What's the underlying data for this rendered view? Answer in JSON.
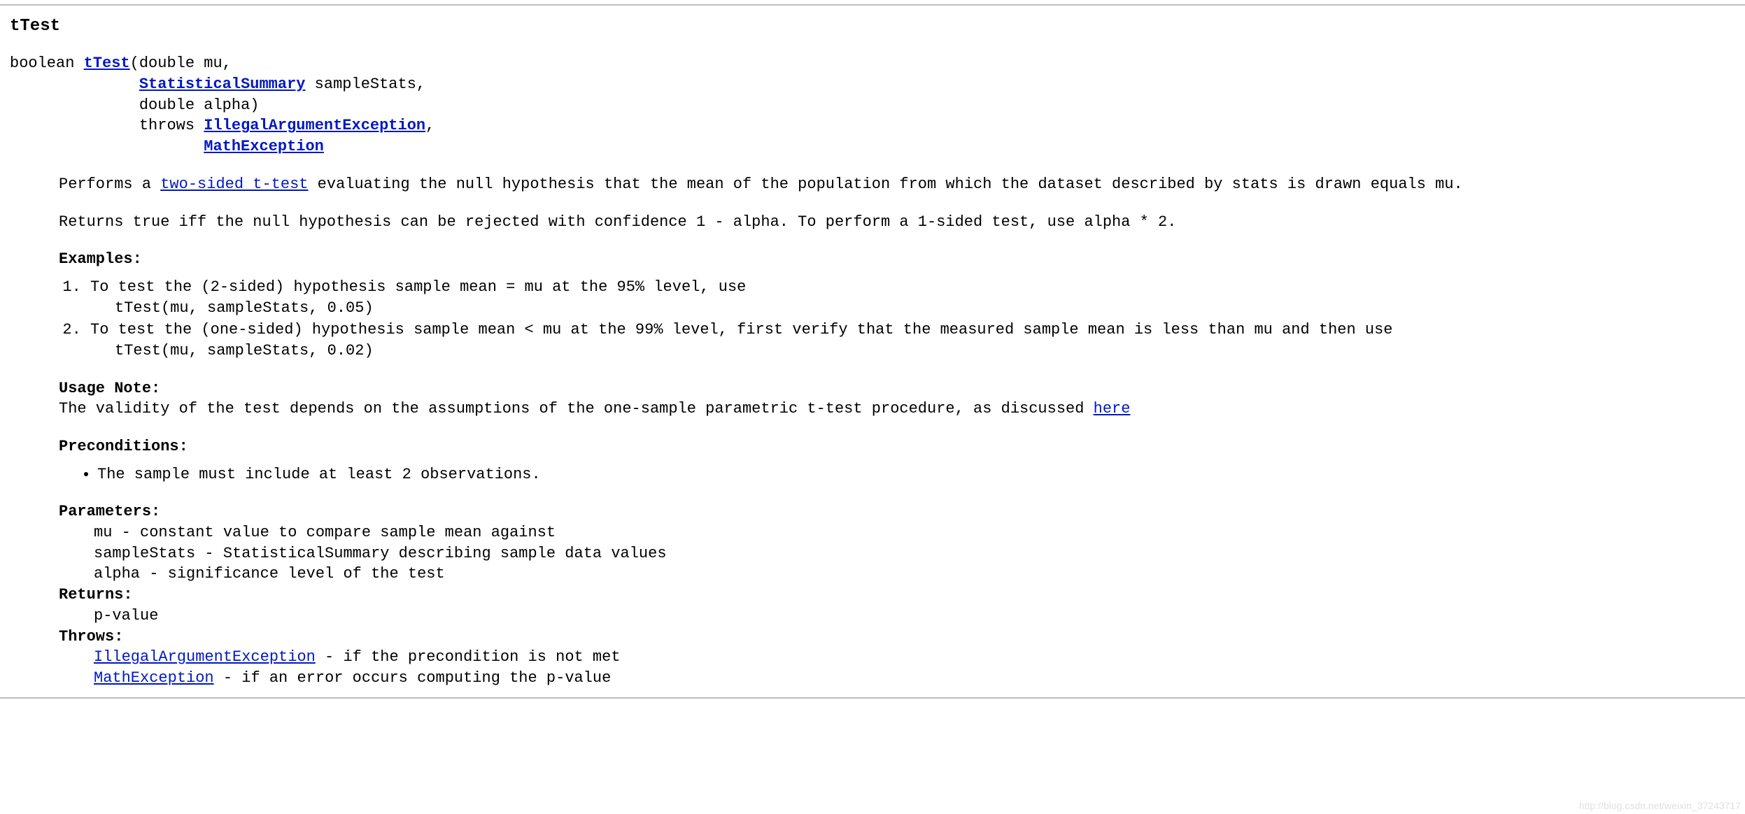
{
  "method": {
    "name": "tTest",
    "signature": {
      "return_type": "boolean ",
      "link_name": "tTest",
      "open": "(double mu,",
      "indent": "              ",
      "param_type_link": "StatisticalSummary",
      "param2_rest": " sampleStats,",
      "param3": "double alpha)",
      "throws_kw": "throws ",
      "throws_indent": "                     ",
      "ex1": "IllegalArgumentException",
      "comma": ",",
      "ex2": "MathException"
    }
  },
  "desc": {
    "p1_a": "Performs a ",
    "p1_link": "two-sided t-test",
    "p1_b": " evaluating the null hypothesis that the mean of the population from which the dataset described by stats is drawn equals mu.",
    "p2": "Returns true iff the null hypothesis can be rejected with confidence 1 - alpha. To perform a 1-sided test, use alpha * 2."
  },
  "examples": {
    "heading": "Examples:",
    "items": [
      {
        "line1": "To test the (2-sided) hypothesis sample mean = mu at the 95% level, use",
        "line2": "tTest(mu, sampleStats, 0.05)"
      },
      {
        "line1": "To test the (one-sided) hypothesis sample mean < mu at the 99% level, first verify that the measured sample mean is less than mu and then use",
        "line2": "tTest(mu, sampleStats, 0.02)"
      }
    ]
  },
  "usage": {
    "heading": "Usage Note:",
    "text_a": "The validity of the test depends on the assumptions of the one-sample parametric t-test procedure, as discussed ",
    "link": "here"
  },
  "precond": {
    "heading": "Preconditions:",
    "items": [
      "The sample must include at least 2 observations."
    ]
  },
  "params": {
    "heading": "Parameters:",
    "items": [
      "mu - constant value to compare sample mean against",
      "sampleStats - StatisticalSummary describing sample data values",
      "alpha - significance level of the test"
    ]
  },
  "returns": {
    "heading": "Returns:",
    "value": "p-value"
  },
  "throws": {
    "heading": "Throws:",
    "items": [
      {
        "link": "IllegalArgumentException",
        "rest": " - if the precondition is not met"
      },
      {
        "link": "MathException",
        "rest": " - if an error occurs computing the p-value"
      }
    ]
  },
  "watermark": "http://blog.csdn.net/weixin_37243717"
}
